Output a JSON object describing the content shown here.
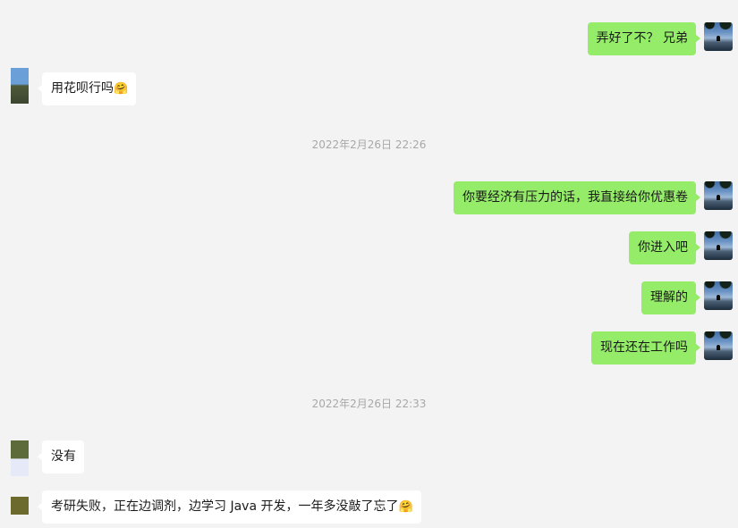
{
  "messages": [
    {
      "side": "me",
      "text": "弄好了不？ 兄弟"
    },
    {
      "side": "other",
      "text": "用花呗行吗",
      "emoji": "🤗"
    },
    {
      "type": "time",
      "text": "2022年2月26日 22:26"
    },
    {
      "side": "me",
      "text": "你要经济有压力的话，我直接给你优惠卷"
    },
    {
      "side": "me",
      "text": "你进入吧"
    },
    {
      "side": "me",
      "text": "理解的"
    },
    {
      "side": "me",
      "text": "现在还在工作吗"
    },
    {
      "type": "time",
      "text": "2022年2月26日 22:33"
    },
    {
      "side": "other",
      "text": "没有"
    },
    {
      "side": "other",
      "text": "考研失败，正在边调剂，边学习 Java 开发，一年多没敲了忘了",
      "emoji": "🤗"
    }
  ],
  "colors": {
    "me_bubble": "#95ec69",
    "other_bubble": "#ffffff",
    "background": "#f3f3f3",
    "timestamp": "#a8a8a8"
  }
}
